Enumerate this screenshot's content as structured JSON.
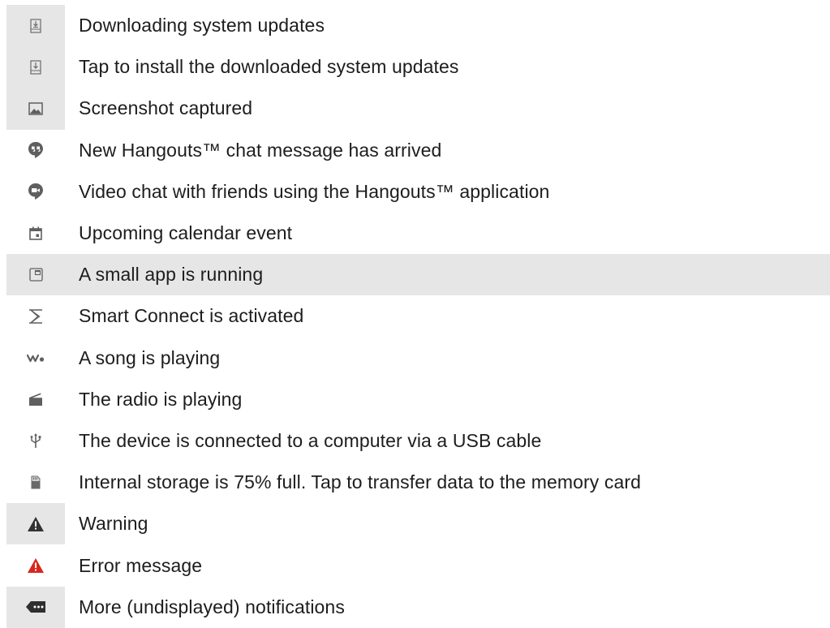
{
  "rows": [
    {
      "icon": "download-update-icon",
      "label": "Downloading system updates"
    },
    {
      "icon": "install-update-icon",
      "label": "Tap to install the downloaded system updates"
    },
    {
      "icon": "screenshot-icon",
      "label": "Screenshot captured"
    },
    {
      "icon": "hangouts-chat-icon",
      "label": "New Hangouts™ chat message has arrived"
    },
    {
      "icon": "hangouts-video-icon",
      "label": "Video chat with friends using the Hangouts™ application"
    },
    {
      "icon": "calendar-icon",
      "label": "Upcoming calendar event"
    },
    {
      "icon": "small-app-icon",
      "label": "A small app is running"
    },
    {
      "icon": "smart-connect-icon",
      "label": "Smart Connect is activated"
    },
    {
      "icon": "walkman-icon",
      "label": "A song is playing"
    },
    {
      "icon": "radio-icon",
      "label": "The radio is playing"
    },
    {
      "icon": "usb-icon",
      "label": "The device is connected to a computer via a USB cable"
    },
    {
      "icon": "storage-icon",
      "label": "Internal storage is 75% full. Tap to transfer data to the memory card"
    },
    {
      "icon": "warning-icon",
      "label": "Warning"
    },
    {
      "icon": "error-icon",
      "label": "Error message"
    },
    {
      "icon": "more-notifications-icon",
      "label": "More (undisplayed) notifications"
    }
  ],
  "colors": {
    "icon_gray": "#5f5f5f",
    "error_red": "#d8271c",
    "row_shade": "#e6e6e6"
  }
}
